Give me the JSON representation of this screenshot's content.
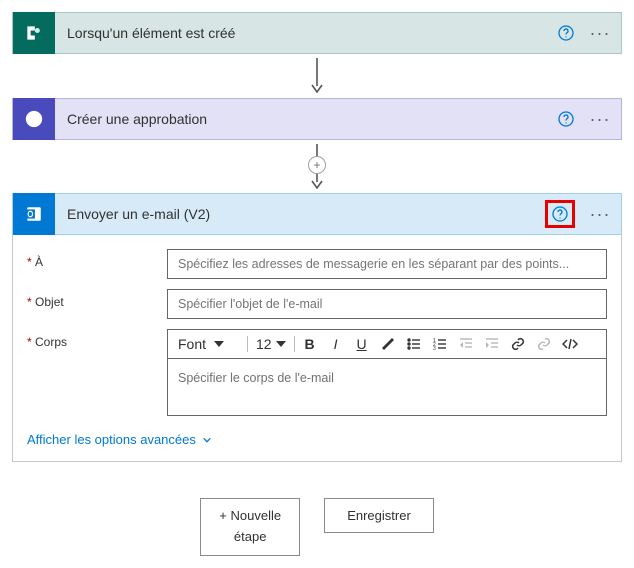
{
  "steps": {
    "sharepoint": {
      "title": "Lorsqu'un élément est créé"
    },
    "approval": {
      "title": "Créer une approbation"
    },
    "email": {
      "title": "Envoyer un e-mail (V2)"
    }
  },
  "email_form": {
    "to_label": "À",
    "to_placeholder": "Spécifiez les adresses de messagerie en les séparant par des points...",
    "subject_label": "Objet",
    "subject_placeholder": "Spécifier l'objet de l'e-mail",
    "body_label": "Corps",
    "body_placeholder": "Spécifier le corps de l'e-mail",
    "font_label": "Font",
    "font_size": "12",
    "advanced_label": "Afficher les options avancées"
  },
  "actions": {
    "new_step_plus": "+ Nouvelle",
    "new_step_sub": "étape",
    "save": "Enregistrer"
  }
}
